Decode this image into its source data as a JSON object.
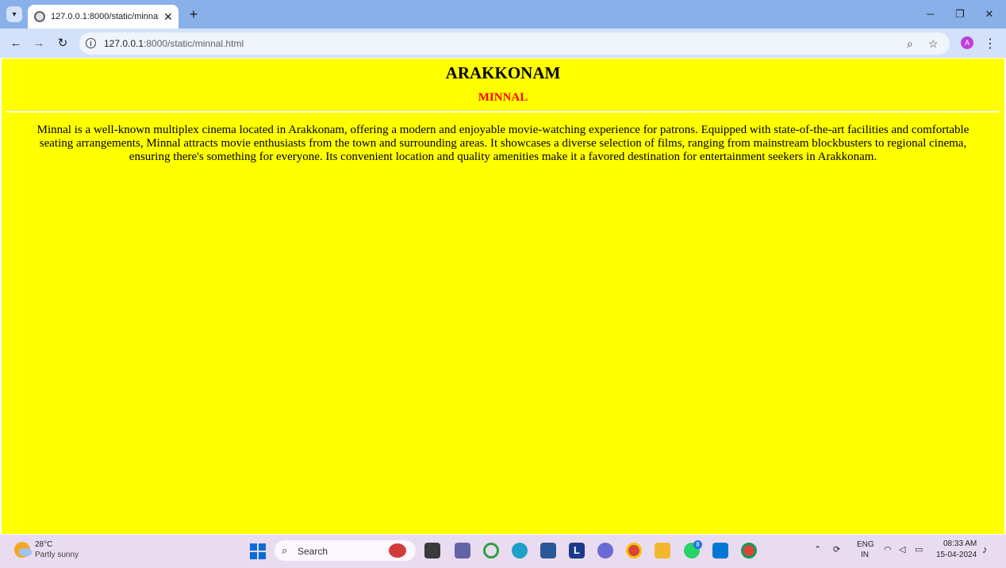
{
  "browser": {
    "tab_title": "127.0.0.1:8000/static/minnal.html",
    "url_host": "127.0.0.1",
    "url_rest": ":8000/static/minnal.html",
    "profile_initial": "A"
  },
  "page": {
    "heading": "ARAKKONAM",
    "subheading": "MINNAL",
    "paragraph": "Minnal is a well-known multiplex cinema located in Arakkonam, offering a modern and enjoyable movie-watching experience for patrons. Equipped with state-of-the-art facilities and comfortable seating arrangements, Minnal attracts movie enthusiasts from the town and surrounding areas. It showcases a diverse selection of films, ranging from mainstream blockbusters to regional cinema, ensuring there's something for everyone. Its convenient location and quality amenities make it a favored destination for entertainment seekers in Arakkonam.",
    "background_color": "#ffff00",
    "subheading_color": "#ff0000"
  },
  "taskbar": {
    "temperature": "28°C",
    "condition": "Partly sunny",
    "search_label": "Search",
    "whatsapp_badge": "8",
    "lang_line1": "ENG",
    "lang_line2": "IN",
    "time": "08:33 AM",
    "date": "15-04-2024"
  }
}
